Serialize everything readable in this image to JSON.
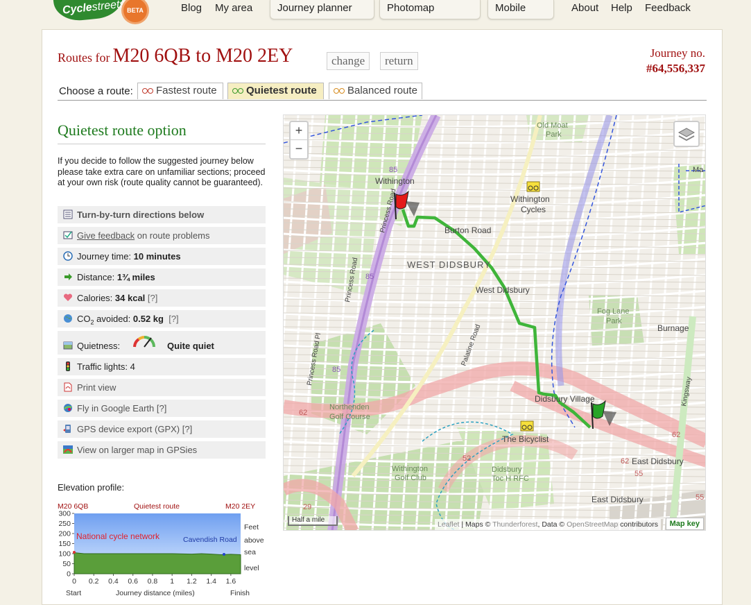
{
  "nav": {
    "logo_main": "Cycle",
    "logo_light": "streets",
    "beta": "BETA",
    "blog": "Blog",
    "my_area": "My area",
    "journey_planner": "Journey planner",
    "photomap": "Photomap",
    "mobile": "Mobile",
    "about": "About",
    "help": "Help",
    "feedback": "Feedback"
  },
  "header": {
    "routes_for": "Routes for",
    "route_title": "M20 6QB to M20 2EY",
    "change": "change",
    "return": "return",
    "journey_no_label": "Journey no.",
    "journey_no": "#64,556,337"
  },
  "choose": {
    "label": "Choose a route:",
    "tabs": [
      {
        "label": "Fastest route",
        "color": "#c0392b",
        "active": false
      },
      {
        "label": "Quietest route",
        "color": "#3a9a2a",
        "active": true
      },
      {
        "label": "Balanced route",
        "color": "#d68a1c",
        "active": false
      }
    ]
  },
  "option": {
    "title": "Quietest route option",
    "disclaimer": "If you decide to follow the suggested journey below please take extra care on unfamiliar sections; proceed at your own risk (route quality cannot be guaranteed)."
  },
  "info": {
    "directions": "Turn-by-turn directions below",
    "feedback_link": "Give feedback",
    "feedback_rest": " on route problems",
    "journey_time_label": "Journey time: ",
    "journey_time": "10 minutes",
    "distance_label": "Distance: ",
    "distance": "1¾ miles",
    "calories_label": "Calories: ",
    "calories": "34 kcal",
    "help_mark": "[?]",
    "co2_label": "CO",
    "co2_sub": "2",
    "co2_rest": " avoided: ",
    "co2": "0.52 kg",
    "quietness_label": "Quietness:",
    "quietness": "Quite quiet",
    "traffic_lights": "Traffic lights: 4",
    "print_view": "Print view",
    "fly_earth": "Fly in Google Earth [?]",
    "gps_export": "GPS device export (GPX) [?]",
    "gpsies": "View on larger map in GPSies"
  },
  "elevation": {
    "label": "Elevation profile:",
    "start_code": "M20 6QB",
    "route_name": "Quietest route",
    "end_code": "M20 2EY",
    "ncn": "National cycle network",
    "road": "Cavendish Road",
    "unit_lines": [
      "Feet",
      "above",
      "sea",
      "level"
    ],
    "start": "Start",
    "xlabel": "Journey distance (miles)",
    "finish": "Finish"
  },
  "chart_data": {
    "type": "area",
    "x": [
      0,
      0.1,
      0.2,
      0.4,
      0.6,
      0.8,
      1.0,
      1.2,
      1.3,
      1.4,
      1.5,
      1.6,
      1.7
    ],
    "y": [
      105,
      100,
      100,
      100,
      100,
      100,
      100,
      98,
      100,
      98,
      95,
      97,
      95
    ],
    "xticks": [
      "0",
      "0.2",
      "0.4",
      "0.6",
      "0.8",
      "1",
      "1.2",
      "1.4",
      "1.6"
    ],
    "yticks": [
      "0",
      "50",
      "100",
      "150",
      "200",
      "250",
      "300"
    ],
    "xlim": [
      0,
      1.7
    ],
    "ylim": [
      0,
      300
    ],
    "ylabel": "Feet above sea level",
    "xlabel": "Journey distance (miles)"
  },
  "map": {
    "zoom_in": "+",
    "zoom_out": "−",
    "scale": "Half a mile",
    "attrib_leaflet": "Leaflet",
    "attrib_mid": " | Maps © ",
    "attrib_tf": "Thunderforest",
    "attrib_data": ", Data © ",
    "attrib_osm": "OpenStreetMap",
    "attrib_end": " contributors",
    "map_key": "Map key",
    "labels": {
      "withington": "Withington",
      "withington_cycles_1": "Withington",
      "withington_cycles_2": "Cycles",
      "old_moat_1": "Old Moat",
      "old_moat_2": "Park",
      "burton_road": "Burton Road",
      "west_didsbury_area": "WEST DIDSBURY",
      "west_didsbury": "West Didsbury",
      "fog_lane_1": "Fog Lane",
      "fog_lane_2": "Park",
      "burnage": "Burnage",
      "didsbury_village": "Didsbury Village",
      "the_bicyclist": "The Bicyclist",
      "northenden_1": "Northenden",
      "northenden_2": "Golf Course",
      "withington_golf_1": "Withington",
      "withington_golf_2": "Golf Club",
      "didsbury_toc_1": "Didsbury",
      "didsbury_toc_2": "Toc H RFC",
      "east_didsbury_1": "East Didsbury",
      "east_didsbury_2": "East Didsbury",
      "palatine_road": "Palatine Road",
      "princess_road": "Princess Road",
      "princess_road_2": "Princess Road",
      "princess_parkway": "Princess Road Pl",
      "kingsway": "Kingsway",
      "ma": "Ma",
      "r85a": "85",
      "r85b": "85",
      "r85c": "85",
      "r62a": "62",
      "r62b": "62",
      "r62c": "62",
      "r55a": "55",
      "r55b": "55",
      "r29": "29",
      "r52": "52"
    }
  }
}
